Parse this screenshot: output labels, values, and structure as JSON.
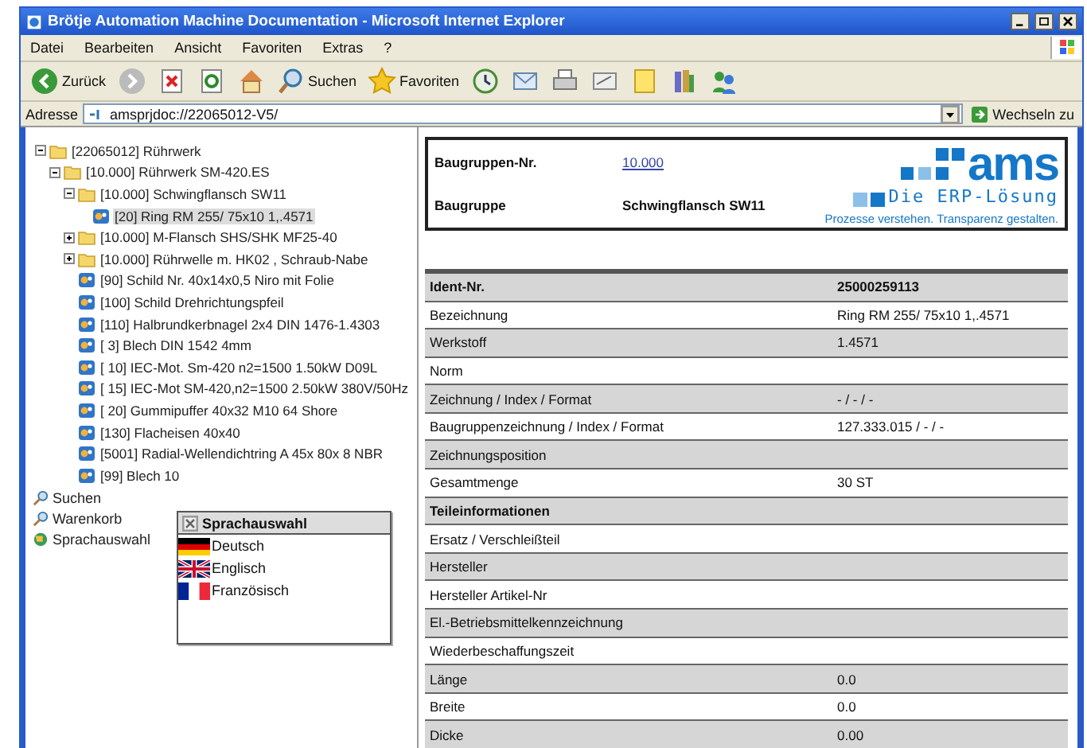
{
  "window": {
    "title": "Brötje Automation Machine Documentation - Microsoft Internet Explorer"
  },
  "menu": [
    "Datei",
    "Bearbeiten",
    "Ansicht",
    "Favoriten",
    "Extras",
    "?"
  ],
  "toolbar": [
    {
      "kind": "back",
      "label": "Zurück"
    },
    {
      "kind": "forward"
    },
    {
      "kind": "stop"
    },
    {
      "kind": "refresh"
    },
    {
      "kind": "home"
    },
    {
      "kind": "search",
      "label": "Suchen"
    },
    {
      "kind": "favorites",
      "label": "Favoriten"
    },
    {
      "kind": "history"
    },
    {
      "kind": "mail"
    },
    {
      "kind": "print"
    },
    {
      "kind": "edit"
    },
    {
      "kind": "note"
    },
    {
      "kind": "tools"
    },
    {
      "kind": "messenger"
    }
  ],
  "address": {
    "label": "Adresse",
    "value": "amsprjdoc://22065012-V5/",
    "go": "Wechseln zu"
  },
  "tree": [
    {
      "label": "[22065012] Rührwerk",
      "kind": "folder",
      "expanded": true,
      "selected": false,
      "children": [
        {
          "label": "[10.000] Rührwerk SM-420.ES",
          "kind": "folder",
          "expanded": true,
          "selected": false,
          "children": [
            {
              "label": "[10.000] Schwingflansch SW11",
              "kind": "folder",
              "expanded": true,
              "selected": false,
              "children": [
                {
                  "label": "[20] Ring RM 255/ 75x10 1,.4571",
                  "kind": "part",
                  "selected": true
                }
              ]
            },
            {
              "label": "[10.000] M-Flansch SHS/SHK MF25-40",
              "kind": "folder",
              "expanded": false,
              "selected": false
            },
            {
              "label": "[10.000] Rührwelle m. HK02 , Schraub-Nabe",
              "kind": "folder",
              "expanded": false,
              "selected": false
            },
            {
              "label": "[90] Schild Nr. 40x14x0,5 Niro mit Folie",
              "kind": "part",
              "selected": false
            },
            {
              "label": "[100] Schild Drehrichtungspfeil",
              "kind": "part",
              "selected": false
            },
            {
              "label": "[110] Halbrundkerbnagel 2x4 DIN 1476-1.4303",
              "kind": "part",
              "selected": false
            },
            {
              "label": "[ 3] Blech DIN 1542 4mm",
              "kind": "part",
              "selected": false
            },
            {
              "label": "[ 10] IEC-Mot. Sm-420 n2=1500 1.50kW D09L",
              "kind": "part",
              "selected": false
            },
            {
              "label": "[ 15] IEC-Mot SM-420,n2=1500 2.50kW 380V/50Hz",
              "kind": "part",
              "selected": false
            },
            {
              "label": "[ 20] Gummipuffer 40x32 M10 64 Shore",
              "kind": "part",
              "selected": false
            },
            {
              "label": "[130] Flacheisen 40x40",
              "kind": "part",
              "selected": false
            },
            {
              "label": "[5001] Radial-Wellendichtring A 45x 80x 8 NBR",
              "kind": "part",
              "selected": false
            },
            {
              "label": "[99] Blech 10",
              "kind": "part",
              "selected": false
            }
          ]
        }
      ]
    }
  ],
  "nav": [
    {
      "kind": "search",
      "label": "Suchen"
    },
    {
      "kind": "search",
      "label": "Warenkorb"
    },
    {
      "kind": "language",
      "label": "Sprachauswahl"
    }
  ],
  "language_popup": {
    "title": "Sprachauswahl",
    "languages": [
      {
        "kind": "de",
        "label": "Deutsch"
      },
      {
        "kind": "gb",
        "label": "Englisch"
      },
      {
        "kind": "fr",
        "label": "Französisch"
      }
    ]
  },
  "header": {
    "rows": [
      {
        "label": "Baugruppen-Nr.",
        "value": "10.000",
        "link": true
      },
      {
        "label": "Baugruppe",
        "value": "Schwingflansch SW11",
        "link": false
      }
    ],
    "logo": {
      "name": "ams",
      "subtitle": "Die ERP-Lösung",
      "slogan": "Prozesse verstehen. Transparenz gestalten."
    }
  },
  "details": [
    {
      "kind": "heading",
      "label": "Ident-Nr.",
      "value": "25000259113"
    },
    {
      "kind": "field",
      "label": "Bezeichnung",
      "value": "Ring RM 255/ 75x10 1,.4571"
    },
    {
      "kind": "field",
      "label": "Werkstoff",
      "value": "1.4571"
    },
    {
      "kind": "field",
      "label": "Norm"
    },
    {
      "kind": "field",
      "label": "Zeichnung / Index / Format",
      "value": "- / - / -"
    },
    {
      "kind": "field",
      "label": "Baugruppenzeichnung / Index / Format",
      "value": "127.333.015 / - / -"
    },
    {
      "kind": "field",
      "label": "Zeichnungsposition"
    },
    {
      "kind": "field",
      "label": "Gesamtmenge",
      "value": "30 ST"
    },
    {
      "kind": "heading",
      "label": "Teileinformationen"
    },
    {
      "kind": "field",
      "label": "Ersatz / Verschleißteil"
    },
    {
      "kind": "field",
      "label": "Hersteller"
    },
    {
      "kind": "field",
      "label": "Hersteller Artikel-Nr"
    },
    {
      "kind": "field",
      "label": "El.-Betriebsmittelkennzeichnung"
    },
    {
      "kind": "field",
      "label": "Wiederbeschaffungszeit"
    },
    {
      "kind": "field",
      "label": "Länge",
      "value": "0.0"
    },
    {
      "kind": "field",
      "label": "Breite",
      "value": "0.0"
    },
    {
      "kind": "field",
      "label": "Dicke",
      "value": "0.00"
    }
  ]
}
